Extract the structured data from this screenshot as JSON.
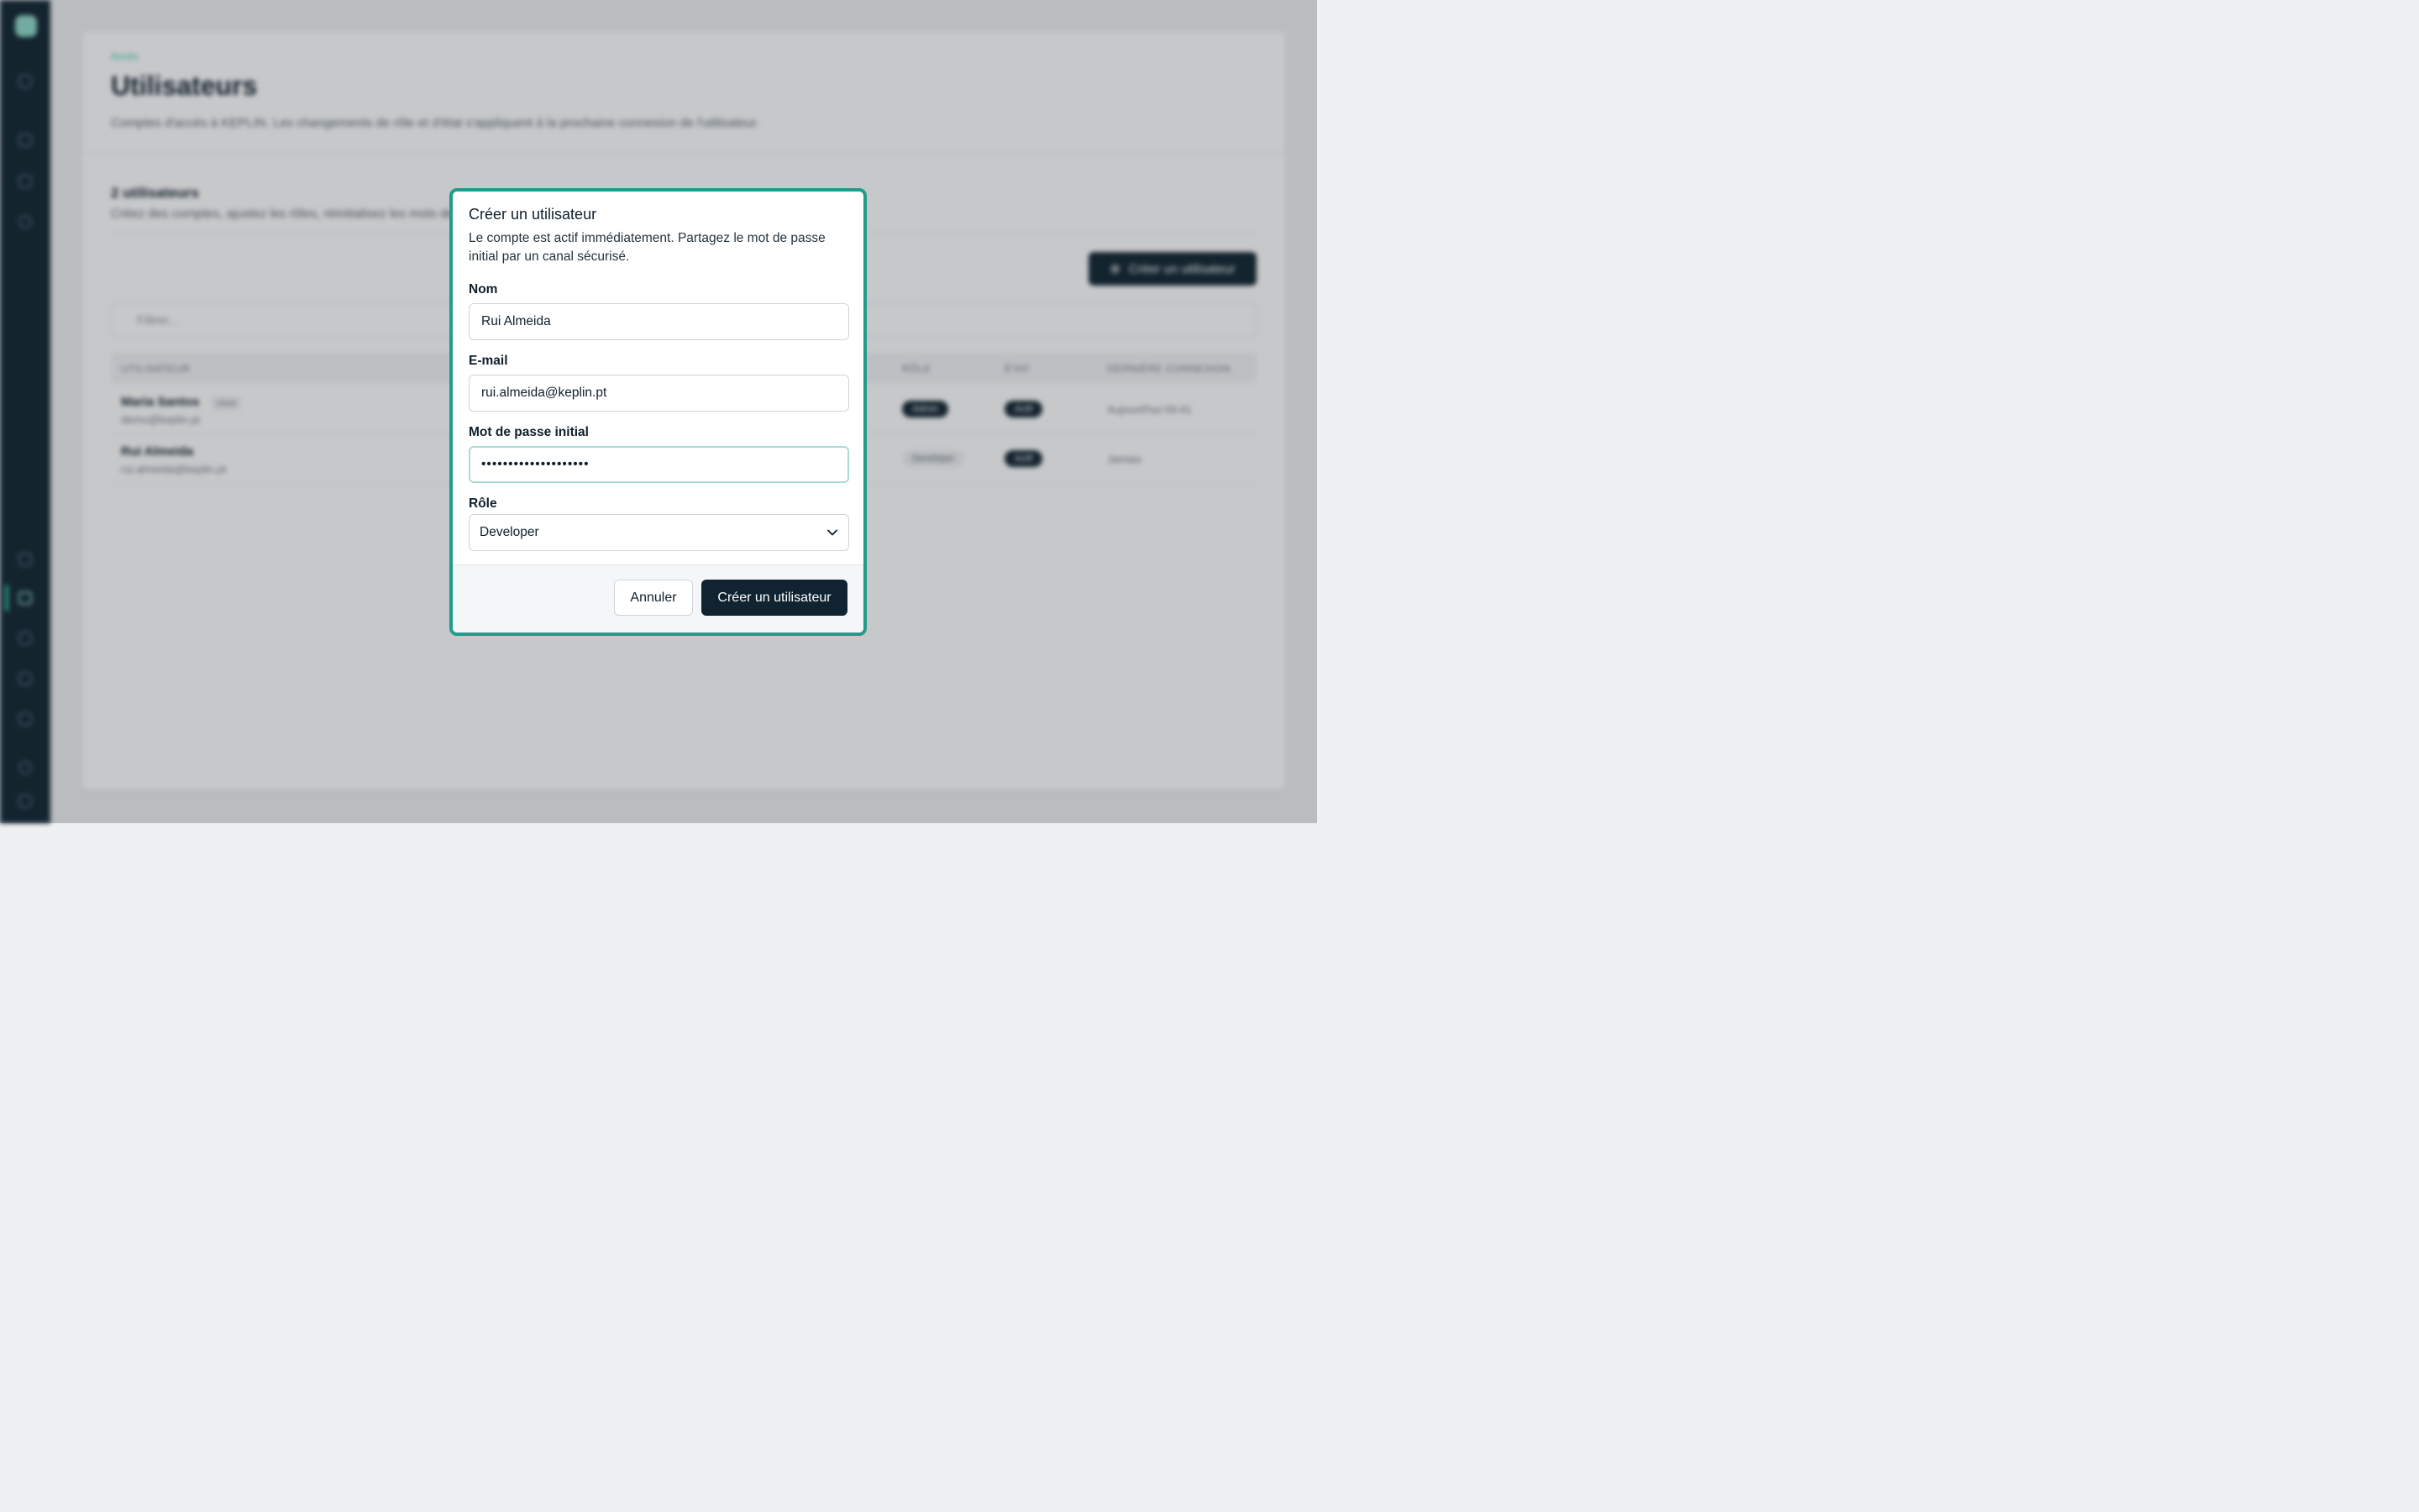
{
  "background": {
    "breadcrumb": "Accès",
    "page_title": "Utilisateurs",
    "page_description": "Comptes d'accès à KEPLIN. Les changements de rôle et d'état s'appliquent à la prochaine connexion de l'utilisateur.",
    "section_title": "2 utilisateurs",
    "section_description": "Créez des comptes, ajustez les rôles, réinitialisez les mots de passe.",
    "create_button": "Créer un utilisateur",
    "filter_placeholder": "Filtrer...",
    "columns": [
      "UTILISATEUR",
      "RÔLE",
      "ÉTAT",
      "DERNIÈRE CONNEXION"
    ],
    "rows": [
      {
        "name": "Maria Santos",
        "tag": "vous",
        "email": "demo@keplin.pt",
        "role": "Admin",
        "state": "Actif",
        "last_login": "Aujourd'hui 09:41"
      },
      {
        "name": "Rui Almeida",
        "tag": "",
        "email": "rui.almeida@keplin.pt",
        "role": "Developer",
        "state": "Actif",
        "last_login": "Jamais"
      }
    ]
  },
  "modal": {
    "title": "Créer un utilisateur",
    "description": "Le compte est actif immédiatement. Partagez le mot de passe initial par un canal sécurisé.",
    "fields": {
      "name": {
        "label": "Nom",
        "value": "Rui Almeida"
      },
      "email": {
        "label": "E-mail",
        "value": "rui.almeida@keplin.pt"
      },
      "password": {
        "label": "Mot de passe initial",
        "value": "••••••••••••••••••••"
      },
      "role": {
        "label": "Rôle",
        "value": "Developer"
      }
    },
    "cancel_label": "Annuler",
    "submit_label": "Créer un utilisateur"
  },
  "colors": {
    "accent": "#1f9c8a",
    "primary": "#0f2430",
    "sidebar": "#0f2430"
  },
  "icons": {
    "role_select": "chevron-down-icon",
    "create_button": "plus-icon",
    "filter": "filter-icon"
  }
}
